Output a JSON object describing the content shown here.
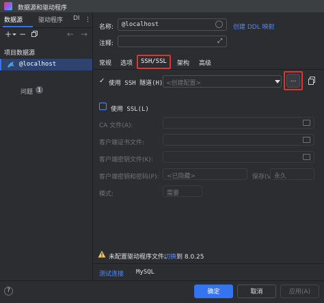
{
  "window": {
    "title": "数据源和驱动程序"
  },
  "left": {
    "tabs": [
      {
        "label": "数据源"
      },
      {
        "label": "驱动程序"
      },
      {
        "label": "DI"
      }
    ],
    "section_title": "项目数据源",
    "datasource": "@localhost",
    "problems_label": "问题",
    "problems_count": "1"
  },
  "right": {
    "name_label": "名称:",
    "name_value": "@localhost",
    "create_ddl_link": "创建 DDL 映射",
    "comment_label": "注释:",
    "tabs": [
      {
        "label": "常规"
      },
      {
        "label": "选项"
      },
      {
        "label": "SSH/SSL"
      },
      {
        "label": "架构"
      },
      {
        "label": "高级"
      }
    ],
    "ssh": {
      "checkbox_label": "使用 SSH 隧道(H)",
      "config_placeholder": "<创建配置>",
      "more_button": "..."
    },
    "ssl": {
      "checkbox_label": "使用 SSL(L)",
      "ca_label": "CA 文件(A):",
      "client_cert_label": "客户端证书文件:",
      "client_key_label": "客户端密钥文件(K):",
      "client_key_pwd_label": "客户端密钥和密码(P):",
      "pwd_placeholder": "<已隐藏>",
      "save_label": "保存(V):",
      "save_value": "永久",
      "mode_label": "模式:",
      "mode_value": "需要"
    },
    "warning": {
      "text": "未配置驱动程序文件。",
      "switch_link": "切换",
      "to_text": "到 8.0.25"
    },
    "test_connection": "测试连接",
    "db_type": "MySQL"
  },
  "buttons": {
    "ok": "确定",
    "cancel": "取消",
    "apply": "应用(A)"
  }
}
